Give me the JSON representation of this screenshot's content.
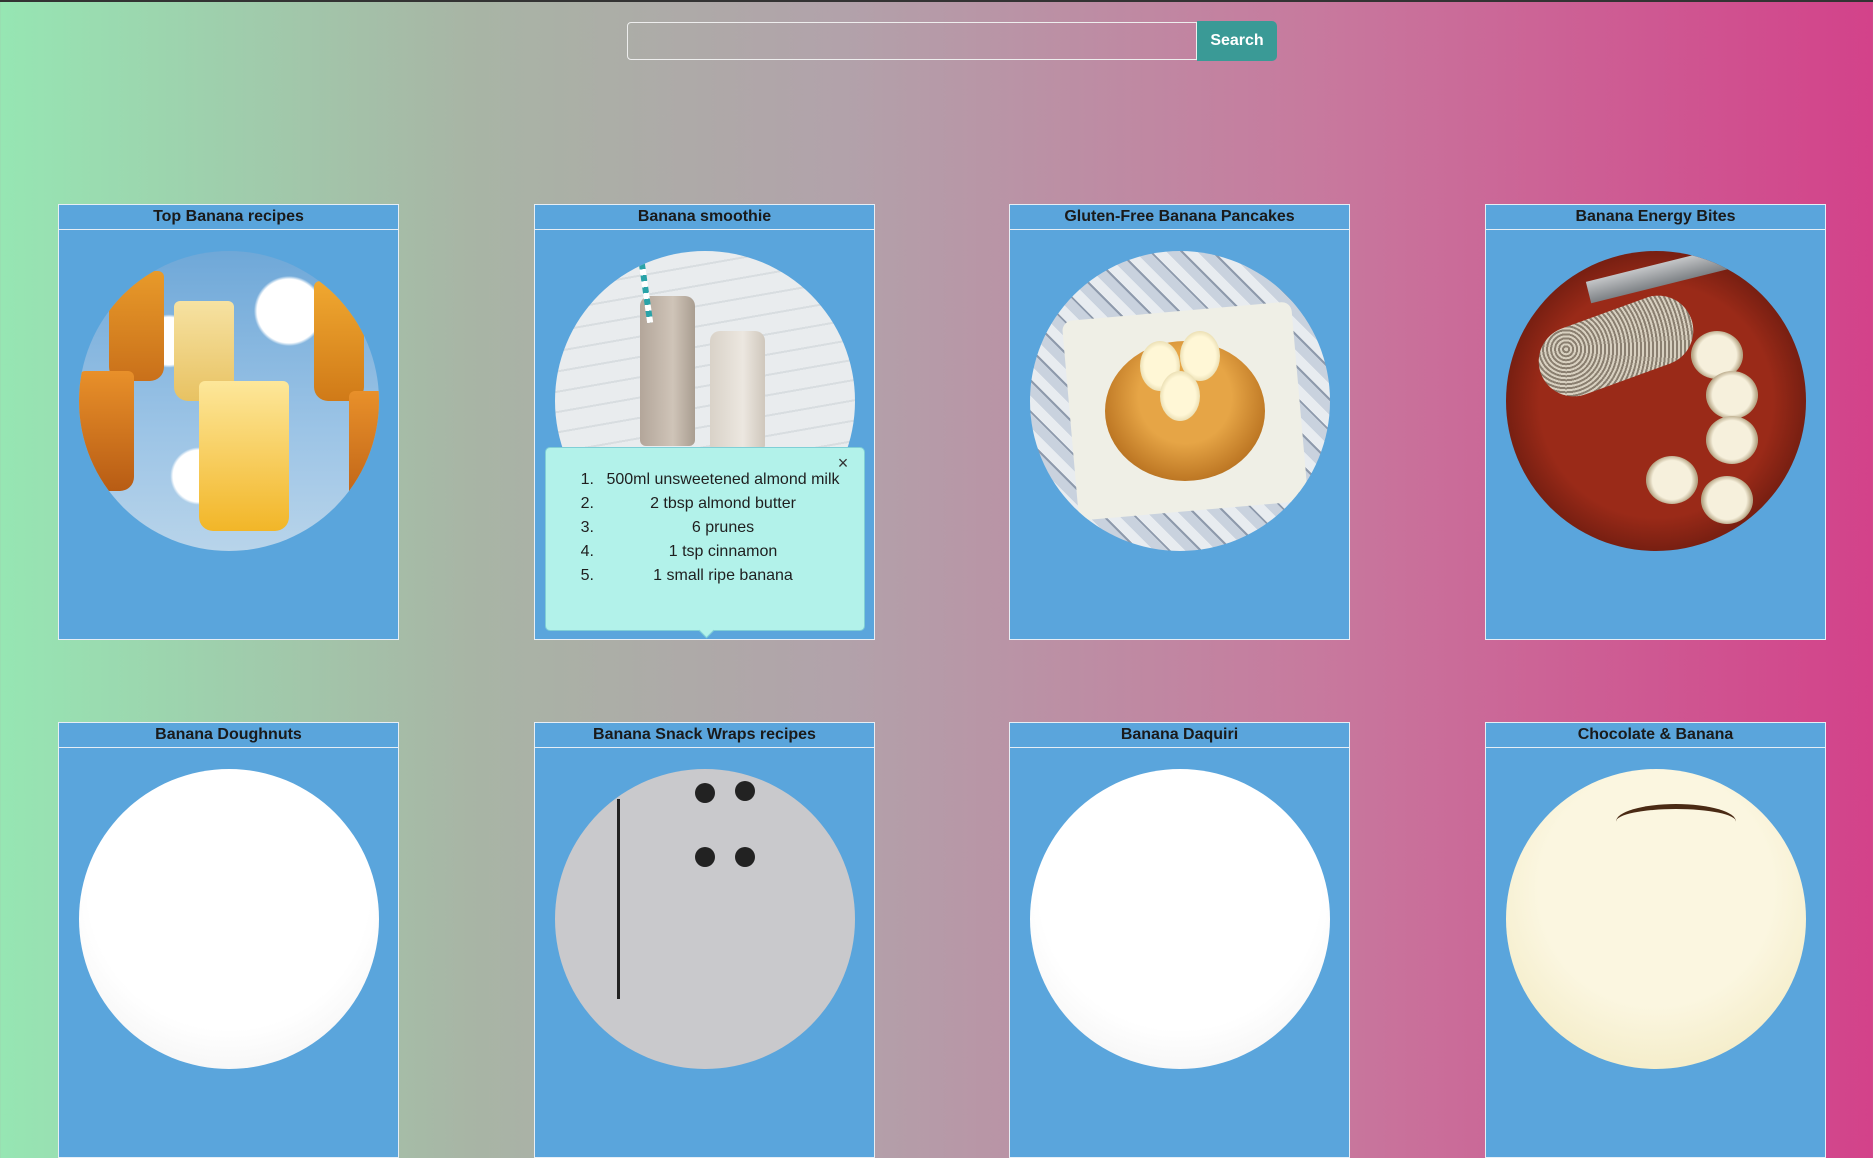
{
  "search": {
    "placeholder": "",
    "button_label": "Search"
  },
  "cards": [
    {
      "title": "Top Banana recipes"
    },
    {
      "title": "Banana smoothie"
    },
    {
      "title": "Gluten-Free Banana Pancakes"
    },
    {
      "title": "Banana Energy Bites"
    },
    {
      "title": "Banana Doughnuts"
    },
    {
      "title": "Banana Snack Wraps recipes"
    },
    {
      "title": "Banana Daquiri"
    },
    {
      "title": "Chocolate & Banana"
    }
  ],
  "popover": {
    "close_label": "×",
    "items": [
      {
        "num": "1.",
        "text": "500ml unsweetened almond milk"
      },
      {
        "num": "2.",
        "text": "2 tbsp almond butter"
      },
      {
        "num": "3.",
        "text": "6 prunes"
      },
      {
        "num": "4.",
        "text": "1 tsp cinnamon"
      },
      {
        "num": "5.",
        "text": "1 small ripe banana"
      }
    ]
  }
}
